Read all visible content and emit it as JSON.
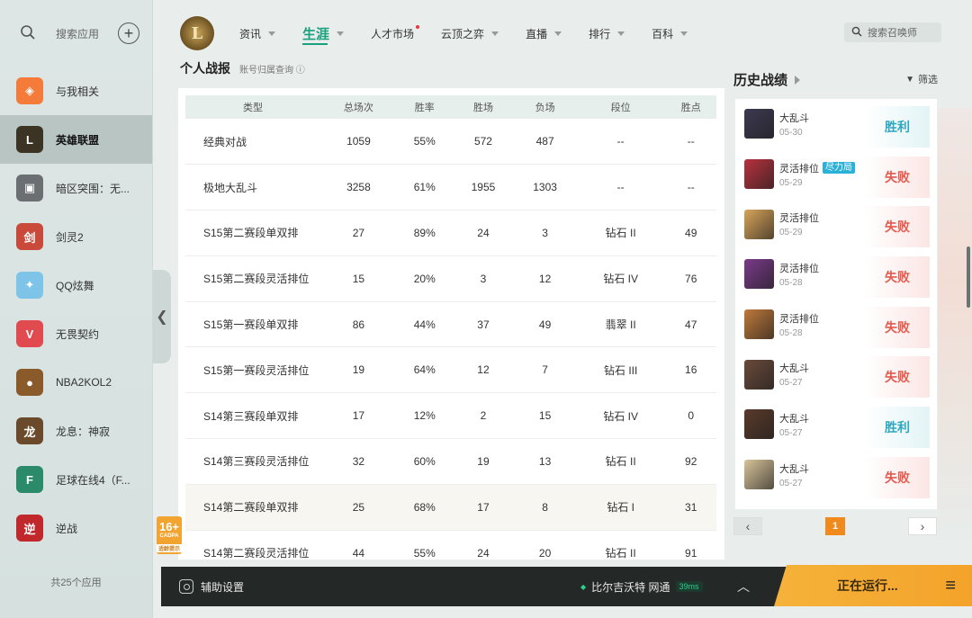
{
  "sidebar": {
    "search_label": "搜索应用",
    "plus_symbol": "+",
    "items": [
      {
        "label": "与我相关",
        "icon": "linked-icon",
        "color": "#f47b3a",
        "glyph": "◈"
      },
      {
        "label": "英雄联盟",
        "icon": "lol-icon",
        "color": "#3b3324",
        "glyph": "L"
      },
      {
        "label": "暗区突围：无...",
        "icon": "dark-zone-icon",
        "color": "#6b6f72",
        "glyph": "▣"
      },
      {
        "label": "剑灵2",
        "icon": "blade-soul-icon",
        "color": "#c94a3a",
        "glyph": "剑"
      },
      {
        "label": "QQ炫舞",
        "icon": "qq-dance-icon",
        "color": "#7ec3e8",
        "glyph": "✦"
      },
      {
        "label": "无畏契约",
        "icon": "valorant-icon",
        "color": "#e14a4f",
        "glyph": "V"
      },
      {
        "label": "NBA2KOL2",
        "icon": "nba-icon",
        "color": "#8a5a2a",
        "glyph": "●"
      },
      {
        "label": "龙息：神寂",
        "icon": "dragon-icon",
        "color": "#6a4a2a",
        "glyph": "龙"
      },
      {
        "label": "足球在线4（F...",
        "icon": "football-icon",
        "color": "#2a8a6a",
        "glyph": "F"
      },
      {
        "label": "逆战",
        "icon": "nizhan-icon",
        "color": "#c0282c",
        "glyph": "逆"
      }
    ],
    "count_label": "共25个应用",
    "active_index": 1
  },
  "nav": {
    "logo_glyph": "L",
    "items": [
      {
        "label": "资讯",
        "chevron": true,
        "active": false,
        "dot": false
      },
      {
        "label": "生涯",
        "chevron": true,
        "active": true,
        "dot": false
      },
      {
        "label": "人才市场",
        "chevron": false,
        "active": false,
        "dot": true
      },
      {
        "label": "云顶之弈",
        "chevron": true,
        "active": false,
        "dot": false
      },
      {
        "label": "直播",
        "chevron": true,
        "active": false,
        "dot": false
      },
      {
        "label": "排行",
        "chevron": true,
        "active": false,
        "dot": false
      },
      {
        "label": "百科",
        "chevron": true,
        "active": false,
        "dot": false
      }
    ],
    "search_placeholder": "搜索召唤师"
  },
  "stats": {
    "title": "个人战报",
    "subtitle": "账号归属查询 ⓘ",
    "columns": [
      "类型",
      "总场次",
      "胜率",
      "胜场",
      "负场",
      "段位",
      "胜点"
    ],
    "rows": [
      [
        "经典对战",
        "1059",
        "55%",
        "572",
        "487",
        "--",
        "--"
      ],
      [
        "极地大乱斗",
        "3258",
        "61%",
        "1955",
        "1303",
        "--",
        "--"
      ],
      [
        "S15第二赛段单双排",
        "27",
        "89%",
        "24",
        "3",
        "钻石 II",
        "49"
      ],
      [
        "S15第二赛段灵活排位",
        "15",
        "20%",
        "3",
        "12",
        "钻石 IV",
        "76"
      ],
      [
        "S15第一赛段单双排",
        "86",
        "44%",
        "37",
        "49",
        "翡翠 II",
        "47"
      ],
      [
        "S15第一赛段灵活排位",
        "19",
        "64%",
        "12",
        "7",
        "钻石 III",
        "16"
      ],
      [
        "S14第三赛段单双排",
        "17",
        "12%",
        "2",
        "15",
        "钻石 IV",
        "0"
      ],
      [
        "S14第三赛段灵活排位",
        "32",
        "60%",
        "19",
        "13",
        "钻石 II",
        "92"
      ],
      [
        "S14第二赛段单双排",
        "25",
        "68%",
        "17",
        "8",
        "钻石 I",
        "31"
      ],
      [
        "S14第二赛段灵活排位",
        "44",
        "55%",
        "24",
        "20",
        "钻石 II",
        "91"
      ]
    ],
    "highlight_row": 8
  },
  "history": {
    "title": "历史战绩",
    "filter_label": "筛选",
    "matches": [
      {
        "mode": "大乱斗",
        "date": "05-30",
        "result": "胜利",
        "win": true,
        "tag": "",
        "champ_color": "#3d3a52"
      },
      {
        "mode": "灵活排位",
        "date": "05-29",
        "result": "失败",
        "win": false,
        "tag": "尽力局",
        "champ_color": "#b8323e"
      },
      {
        "mode": "灵活排位",
        "date": "05-29",
        "result": "失败",
        "win": false,
        "tag": "",
        "champ_color": "#d9a45a"
      },
      {
        "mode": "灵活排位",
        "date": "05-28",
        "result": "失败",
        "win": false,
        "tag": "",
        "champ_color": "#7a3a8a"
      },
      {
        "mode": "灵活排位",
        "date": "05-28",
        "result": "失败",
        "win": false,
        "tag": "",
        "champ_color": "#c07a3a"
      },
      {
        "mode": "大乱斗",
        "date": "05-27",
        "result": "失败",
        "win": false,
        "tag": "",
        "champ_color": "#6a4a3a"
      },
      {
        "mode": "大乱斗",
        "date": "05-27",
        "result": "胜利",
        "win": true,
        "tag": "",
        "champ_color": "#5a3a2a"
      },
      {
        "mode": "大乱斗",
        "date": "05-27",
        "result": "失败",
        "win": false,
        "tag": "",
        "champ_color": "#d8c49a"
      }
    ],
    "pager": {
      "prev": "‹",
      "current": "1",
      "next": "›"
    }
  },
  "age_badge": {
    "age": "16+",
    "label": "CADPA",
    "note": "适龄提示"
  },
  "bottom": {
    "assist_label": "辅助设置",
    "server_label": "比尔吉沃特 网通",
    "ping": "39ms",
    "expand_symbol": "︿",
    "running_label": "正在运行...",
    "menu_symbol": "≡"
  },
  "colors": {
    "accent": "#1aa07f",
    "win": "#2fa7c0",
    "lose": "#e35a4f",
    "running": "#f4a32a",
    "page_active": "#f08a1c"
  }
}
